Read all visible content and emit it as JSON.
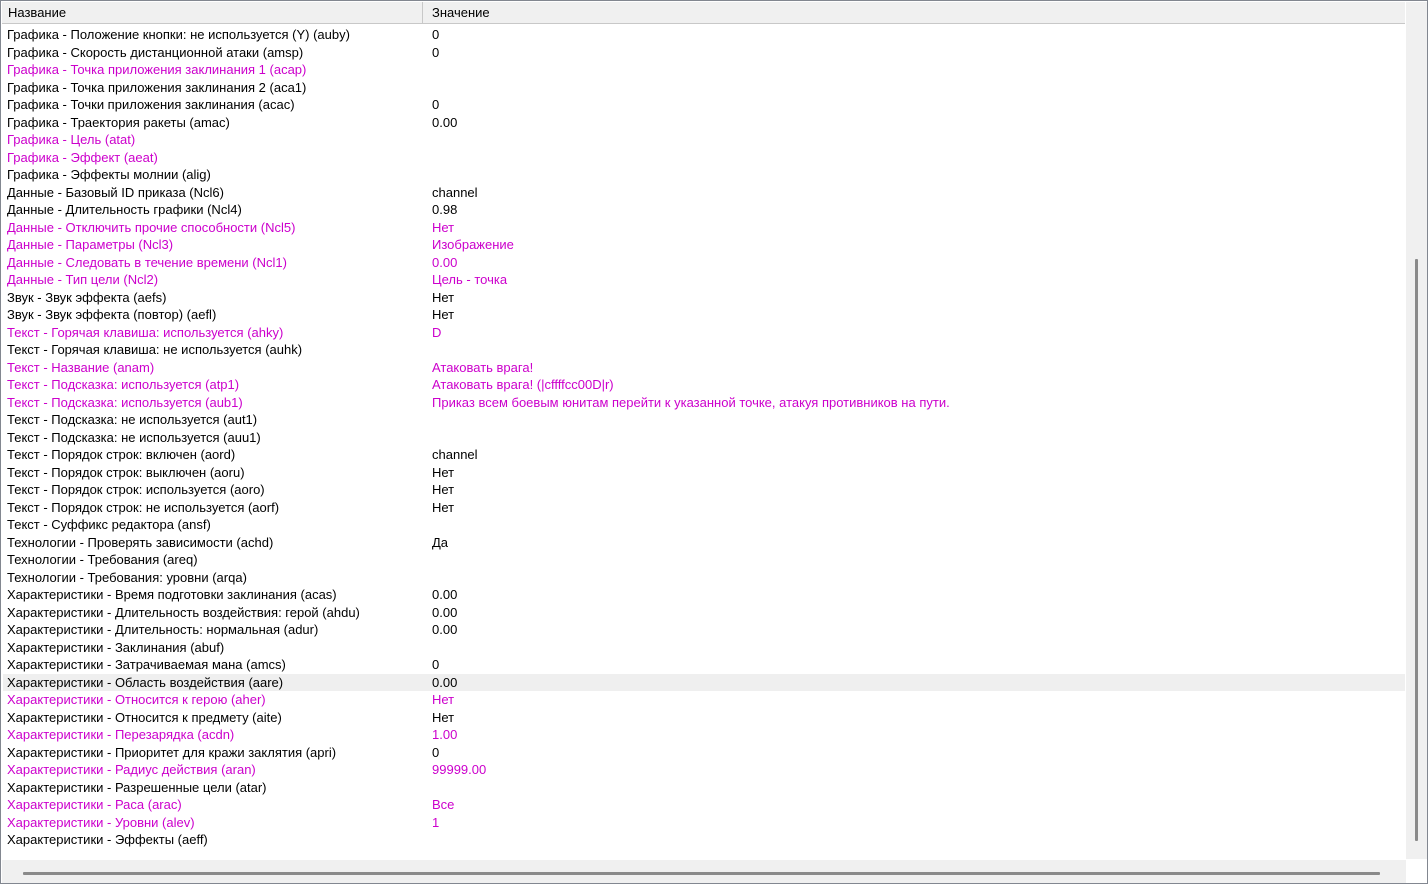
{
  "header": {
    "name_col": "Название",
    "value_col": "Значение"
  },
  "colors": {
    "modified": "#cc00cc",
    "normal": "#000000",
    "selected_bg": "#efefef"
  },
  "selected_index": 37,
  "rows": [
    {
      "name": "Графика - Положение кнопки: не используется (Y) (auby)",
      "value": "0",
      "modified": false
    },
    {
      "name": "Графика - Скорость дистанционной атаки (amsp)",
      "value": "0",
      "modified": false
    },
    {
      "name": "Графика - Точка приложения заклинания 1 (acap)",
      "value": "",
      "modified": true
    },
    {
      "name": "Графика - Точка приложения заклинания 2 (aca1)",
      "value": "",
      "modified": false
    },
    {
      "name": "Графика - Точки приложения заклинания (acac)",
      "value": "0",
      "modified": false
    },
    {
      "name": "Графика - Траектория ракеты (amac)",
      "value": "0.00",
      "modified": false
    },
    {
      "name": "Графика - Цель (atat)",
      "value": "",
      "modified": true
    },
    {
      "name": "Графика - Эффект (aeat)",
      "value": "",
      "modified": true
    },
    {
      "name": "Графика - Эффекты молнии (alig)",
      "value": "",
      "modified": false
    },
    {
      "name": "Данные - Базовый ID приказа (Ncl6)",
      "value": "channel",
      "modified": false
    },
    {
      "name": "Данные - Длительность графики (Ncl4)",
      "value": "0.98",
      "modified": false
    },
    {
      "name": "Данные - Отключить прочие способности (Ncl5)",
      "value": "Нет",
      "modified": true
    },
    {
      "name": "Данные - Параметры (Ncl3)",
      "value": "Изображение",
      "modified": true
    },
    {
      "name": "Данные - Следовать в течение времени (Ncl1)",
      "value": "0.00",
      "modified": true
    },
    {
      "name": "Данные - Тип цели (Ncl2)",
      "value": "Цель - точка",
      "modified": true
    },
    {
      "name": "Звук - Звук эффекта (aefs)",
      "value": "Нет",
      "modified": false
    },
    {
      "name": "Звук - Звук эффекта (повтор) (aefl)",
      "value": "Нет",
      "modified": false
    },
    {
      "name": "Текст - Горячая клавиша: используется (ahky)",
      "value": "D",
      "modified": true
    },
    {
      "name": "Текст - Горячая клавиша: не используется (auhk)",
      "value": "",
      "modified": false
    },
    {
      "name": "Текст - Название (anam)",
      "value": "Атаковать врага!",
      "modified": true
    },
    {
      "name": "Текст - Подсказка: используется (atp1)",
      "value": "Атаковать врага! (|cffffcc00D|r)",
      "modified": true
    },
    {
      "name": "Текст - Подсказка: используется (aub1)",
      "value": "Приказ всем боевым юнитам перейти к указанной точке, атакуя противников на пути.",
      "modified": true
    },
    {
      "name": "Текст - Подсказка: не используется (aut1)",
      "value": "",
      "modified": false
    },
    {
      "name": "Текст - Подсказка: не используется (auu1)",
      "value": "",
      "modified": false
    },
    {
      "name": "Текст - Порядок строк: включен (aord)",
      "value": "channel",
      "modified": false
    },
    {
      "name": "Текст - Порядок строк: выключен (aoru)",
      "value": "Нет",
      "modified": false
    },
    {
      "name": "Текст - Порядок строк: используется (aoro)",
      "value": "Нет",
      "modified": false
    },
    {
      "name": "Текст - Порядок строк: не используется (aorf)",
      "value": "Нет",
      "modified": false
    },
    {
      "name": "Текст - Суффикс редактора (ansf)",
      "value": "",
      "modified": false
    },
    {
      "name": "Технологии - Проверять зависимости (achd)",
      "value": "Да",
      "modified": false
    },
    {
      "name": "Технологии - Требования (areq)",
      "value": "",
      "modified": false
    },
    {
      "name": "Технологии - Требования: уровни (arqa)",
      "value": "",
      "modified": false
    },
    {
      "name": "Характеристики - Время подготовки заклинания (acas)",
      "value": "0.00",
      "modified": false
    },
    {
      "name": "Характеристики - Длительность воздействия: герой (ahdu)",
      "value": "0.00",
      "modified": false
    },
    {
      "name": "Характеристики - Длительность: нормальная (adur)",
      "value": "0.00",
      "modified": false
    },
    {
      "name": "Характеристики - Заклинания (abuf)",
      "value": "",
      "modified": false
    },
    {
      "name": "Характеристики - Затрачиваемая мана (amcs)",
      "value": "0",
      "modified": false
    },
    {
      "name": "Характеристики - Область воздействия (aare)",
      "value": "0.00",
      "modified": false
    },
    {
      "name": "Характеристики - Относится к герою (aher)",
      "value": "Нет",
      "modified": true
    },
    {
      "name": "Характеристики - Относится к предмету (aite)",
      "value": "Нет",
      "modified": false
    },
    {
      "name": "Характеристики - Перезарядка (acdn)",
      "value": "1.00",
      "modified": true
    },
    {
      "name": "Характеристики - Приоритет для кражи заклятия (apri)",
      "value": "0",
      "modified": false
    },
    {
      "name": "Характеристики - Радиус действия (aran)",
      "value": "99999.00",
      "modified": true
    },
    {
      "name": "Характеристики - Разрешенные цели (atar)",
      "value": "",
      "modified": false
    },
    {
      "name": "Характеристики - Раса (arac)",
      "value": "Все",
      "modified": true
    },
    {
      "name": "Характеристики - Уровни (alev)",
      "value": "1",
      "modified": true
    },
    {
      "name": "Характеристики - Эффекты (aeff)",
      "value": "",
      "modified": false
    }
  ]
}
